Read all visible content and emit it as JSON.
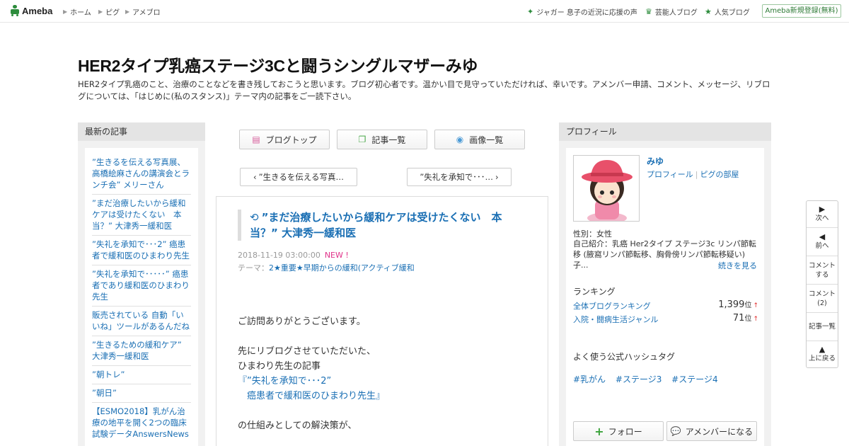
{
  "topbar": {
    "logo": "Ameba",
    "nav": [
      "ホーム",
      "ピグ",
      "アメブロ"
    ],
    "links": [
      {
        "icon": "sparkle-icon",
        "label": "ジャガー 息子の近況に応援の声"
      },
      {
        "icon": "crown-icon",
        "label": "芸能人ブログ"
      },
      {
        "icon": "star-icon",
        "label": "人気ブログ"
      }
    ],
    "register": "Ameba新規登録(無料)"
  },
  "header": {
    "title": "HER2タイプ乳癌ステージ3Cと闘うシングルマザーみゆ",
    "description": "HER2タイプ乳癌のこと、治療のことなどを書き残しておこうと思います。ブログ初心者です。温かい目で見守っていただければ、幸いです。アメンバー申請、コメント、メッセージ、リブログについては、「はじめに(私のスタンス)」テーマ内の記事をご一読下さい。"
  },
  "left": {
    "heading": "最新の記事",
    "items": [
      "”生きるを伝える写真展、高橋絵麻さんの講演会とランチ会” メリーさん",
      "”まだ治療したいから緩和ケアは受けたくない　本当？” 大津秀一緩和医",
      "”失礼を承知で･･･2” 癌患者で緩和医のひまわり先生",
      "”失礼を承知で･････” 癌患者であり緩和医のひまわり先生",
      "販売されている 自動「いいね」ツールがあるんだね",
      "”生きるための緩和ケア” 大津秀一緩和医",
      "”朝トレ”",
      "”朝日”",
      "【ESMO2018】乳がん治療の地平を開く2つの臨床試験データAnswersNews"
    ]
  },
  "center": {
    "buttons": {
      "top": "ブログトップ",
      "list": "記事一覧",
      "images": "画像一覧"
    },
    "prev": "”生きるを伝える写真…",
    "next": "”失礼を承知で･･･…",
    "article": {
      "title": "”まだ治療したいから緩和ケアは受けたくない　本当？” 大津秀一緩和医",
      "date": "2018-11-19 03:00:00",
      "new_badge": "NEW !",
      "theme_label": "テーマ：",
      "theme": "2★重要★早期からの緩和(アクティブ緩和",
      "body": {
        "p1": "ご訪問ありがとうございます。",
        "p2": "先にリブログさせていただいた、",
        "p3": "ひまわり先生の記事",
        "q1": "『”失礼を承知で･･･2”",
        "q2": "　癌患者で緩和医のひまわり先生』",
        "p4": "の仕組みとしての解決策が、"
      }
    }
  },
  "right": {
    "heading": "プロフィール",
    "name": "みゆ",
    "link_profile": "プロフィール",
    "link_pig": "ピグの部屋",
    "gender": "性別：女性",
    "intro": "自己紹介：乳癌 Her2タイプ ステージ3c リンパ節転移 (腋窩リンパ節転移、胸骨傍リンパ節転移疑い) 子...",
    "more": "続きを見る",
    "ranking_heading": "ランキング",
    "ranking": [
      {
        "label": "全体ブログランキング",
        "value": "1,399",
        "unit": "位"
      },
      {
        "label": "入院・闘病生活ジャンル",
        "value": "71",
        "unit": "位"
      }
    ],
    "hashtag_heading": "よく使う公式ハッシュタグ",
    "hashtags": [
      "#乳がん",
      "#ステージ3",
      "#ステージ4"
    ],
    "follow": "フォロー",
    "amember": "アメンバーになる"
  },
  "sidenav": {
    "next": "次へ",
    "prev": "前へ",
    "comment_line1": "コメント",
    "comment_line2": "する",
    "comments_line1": "コメント",
    "comments_line2": "(2)",
    "list": "記事一覧",
    "top": "上に戻る"
  },
  "colors": {
    "accent": "#1a6fb4",
    "brand": "#2d8c3c",
    "new": "#e0328a"
  }
}
